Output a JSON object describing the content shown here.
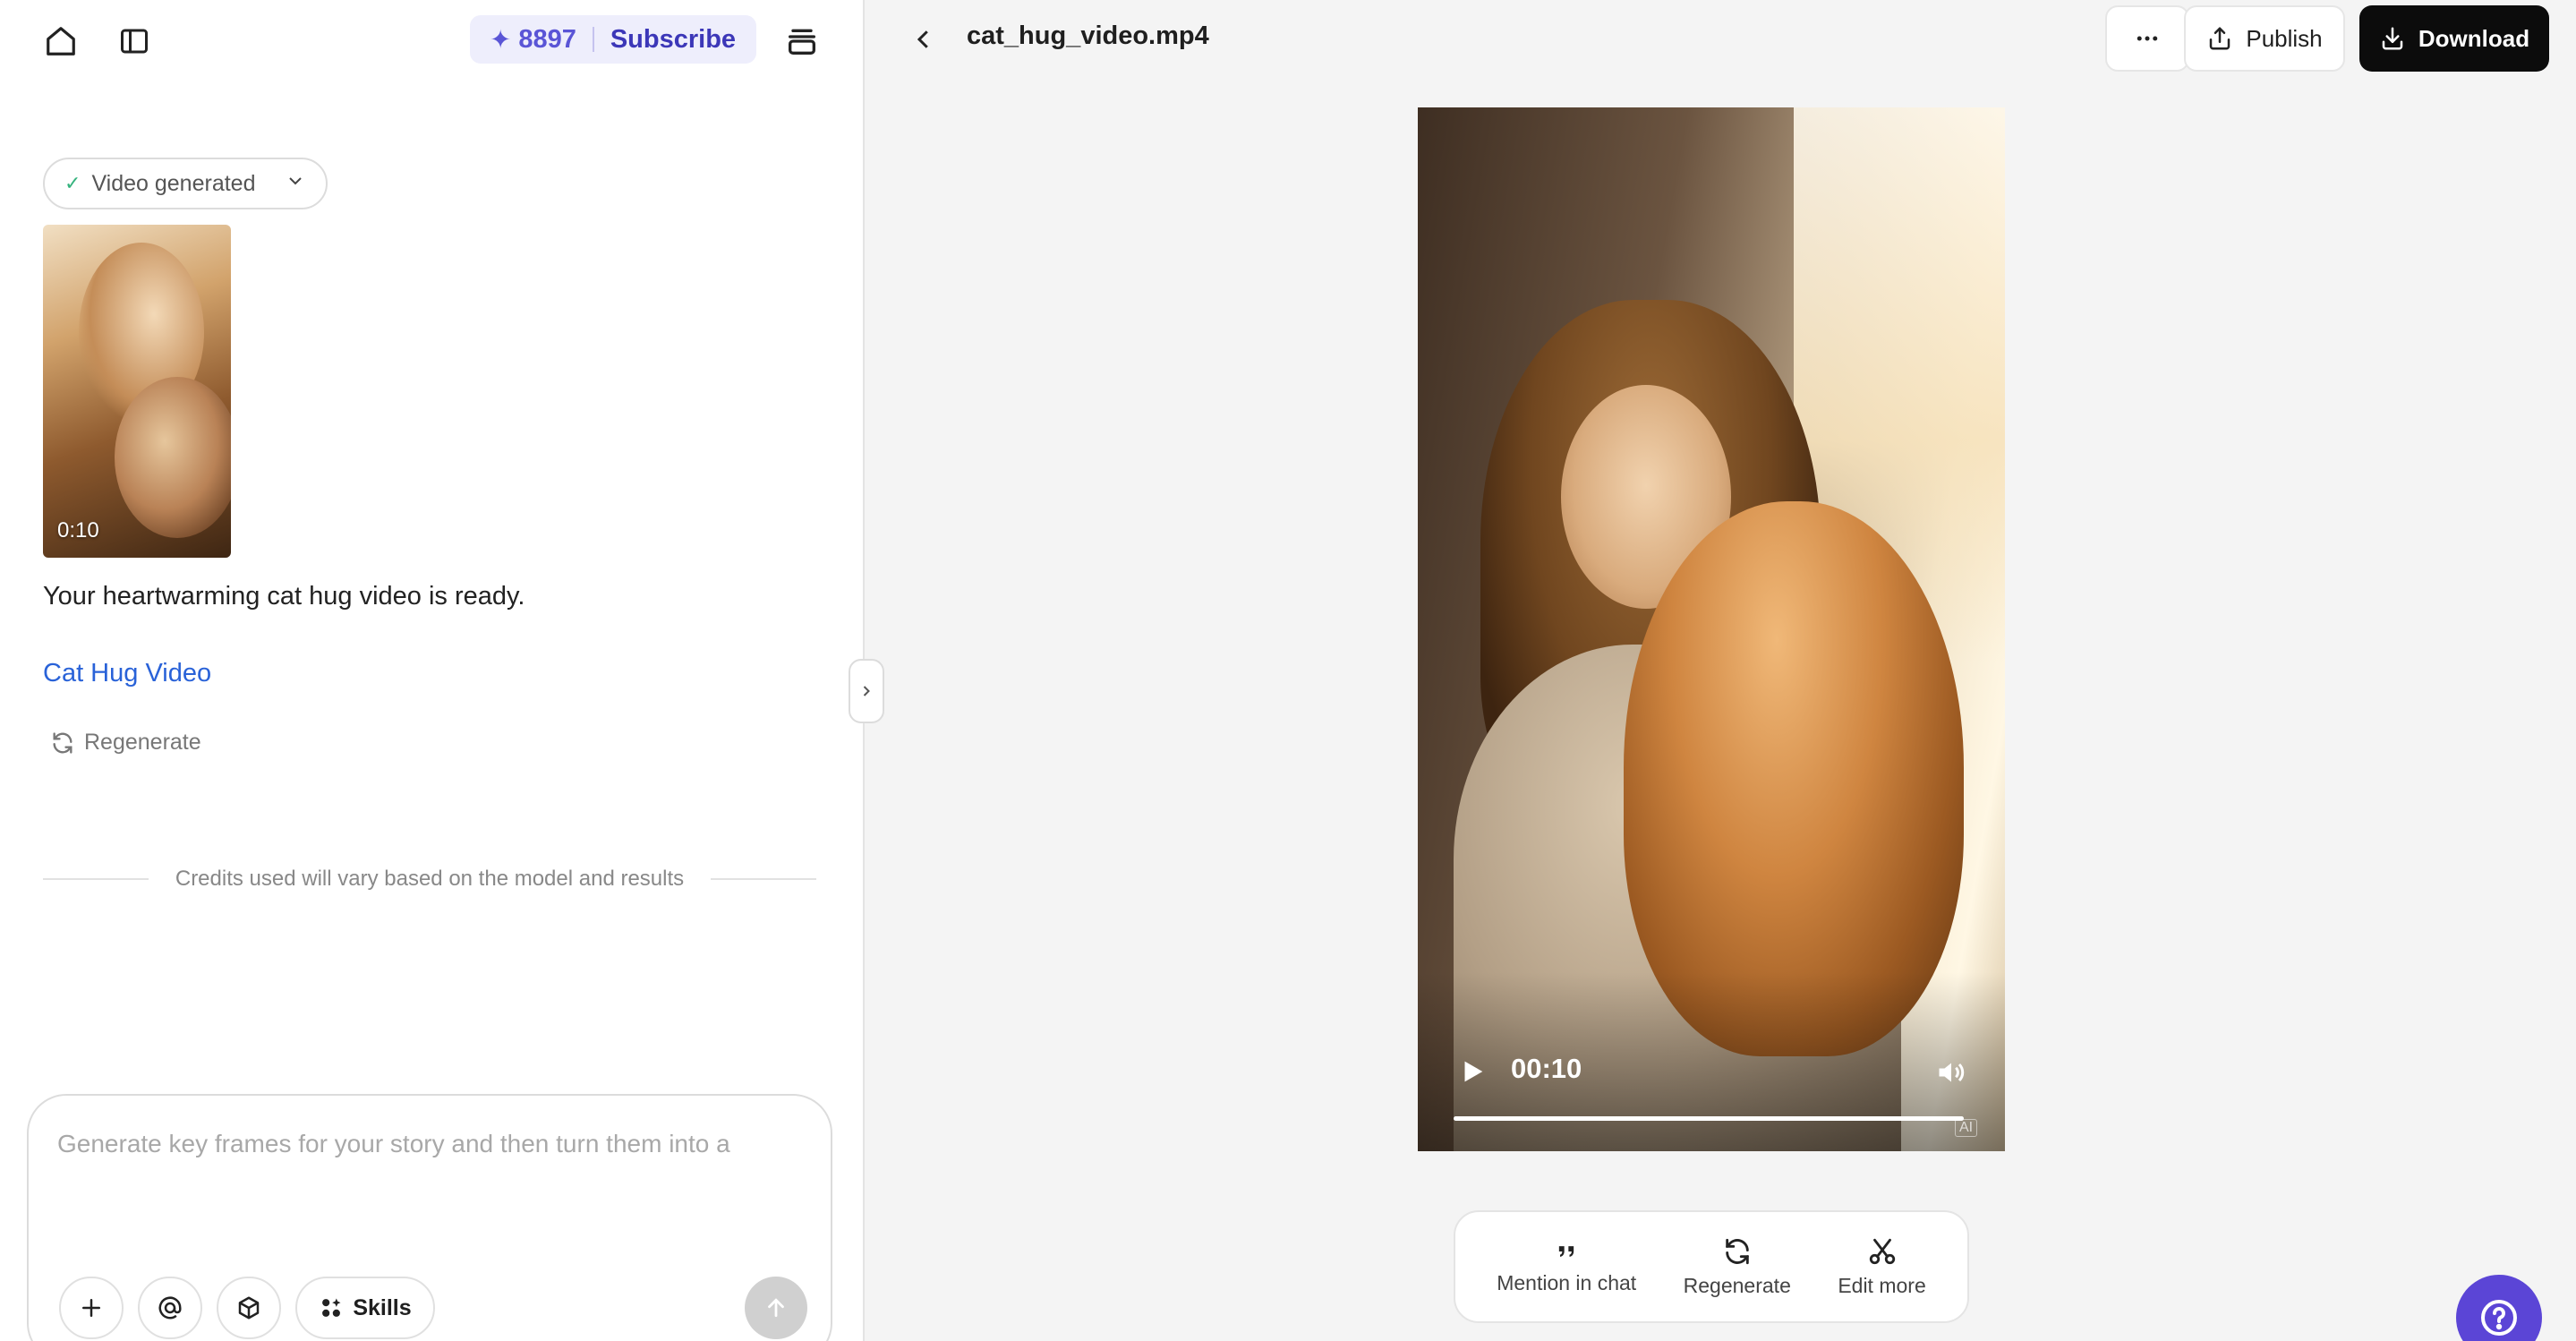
{
  "header": {
    "credits": "8897",
    "subscribe_label": "Subscribe",
    "file_title": "cat_hug_video.mp4",
    "publish_label": "Publish",
    "download_label": "Download"
  },
  "icons": {
    "home": "home-icon",
    "sidebar": "sidebar-toggle-icon",
    "stack": "stack-icon",
    "back": "chevron-left-icon",
    "more": "more-horizontal-icon",
    "publish": "share-upload-icon",
    "download": "download-icon",
    "help": "help-icon"
  },
  "chat": {
    "status_label": "Video generated",
    "thumbnail_duration": "0:10",
    "ready_message": "Your heartwarming cat hug video is ready.",
    "link_text": "Cat Hug Video",
    "regenerate_label": "Regenerate",
    "credits_note": "Credits used will vary based on the model and results"
  },
  "composer": {
    "placeholder": "Generate key frames for your story and then turn them into a",
    "skills_label": "Skills"
  },
  "player": {
    "time": "00:10",
    "progress": 1.0,
    "ai_badge": "AI"
  },
  "actions": {
    "mention_label": "Mention in chat",
    "regenerate_label": "Regenerate",
    "edit_label": "Edit more"
  },
  "colors": {
    "accent": "#5b45d6",
    "link": "#2962d8",
    "download_bg": "#0c0c0c"
  }
}
